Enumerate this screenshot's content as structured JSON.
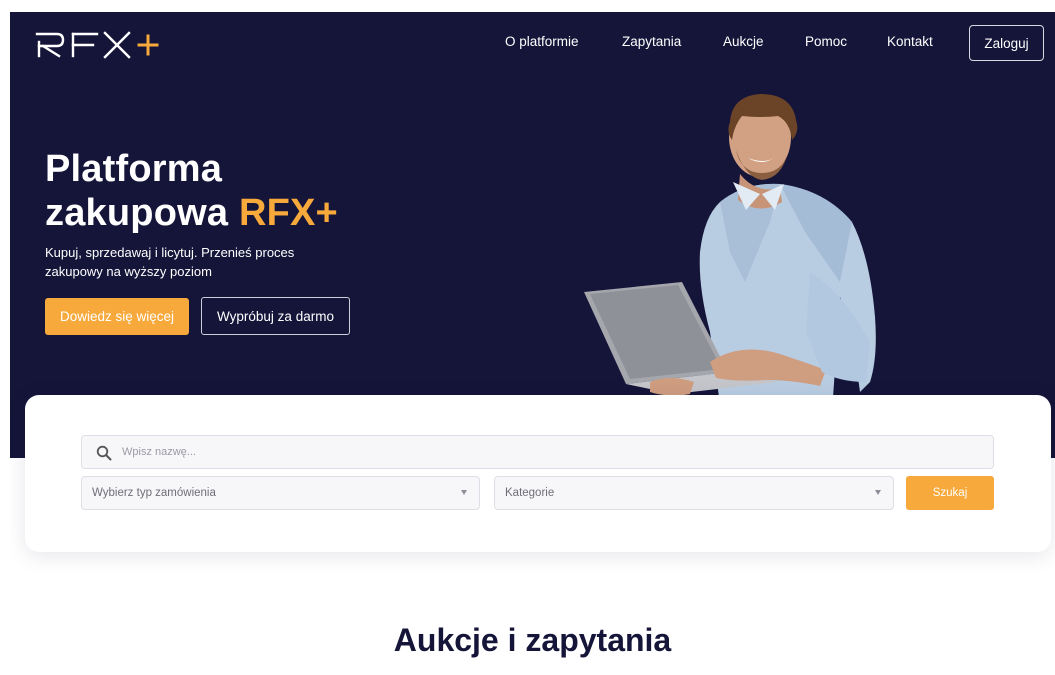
{
  "logo": {
    "text": "RFX",
    "plus": "+"
  },
  "nav": {
    "links": [
      "O platformie",
      "Zapytania",
      "Aukcje",
      "Pomoc",
      "Kontakt"
    ],
    "login": "Zaloguj"
  },
  "hero": {
    "title_line1": "Platforma",
    "title_line2": "zakupowa ",
    "title_accent": "RFX+",
    "subtitle": "Kupuj, sprzedawaj i licytuj. Przenieś proces zakupowy na wyższy poziom",
    "cta_primary": "Dowiedz się więcej",
    "cta_secondary": "Wypróbuj za darmo"
  },
  "search": {
    "placeholder": "Wpisz nazwę...",
    "order_type": "Wybierz typ zamówienia",
    "category": "Kategorie",
    "button": "Szukaj"
  },
  "section": {
    "title": "Aukcje i zapytania"
  },
  "colors": {
    "navy": "#15153a",
    "accent": "#f7a93b",
    "white": "#ffffff"
  },
  "icons": [
    "search-icon",
    "chevron-down-icon"
  ]
}
